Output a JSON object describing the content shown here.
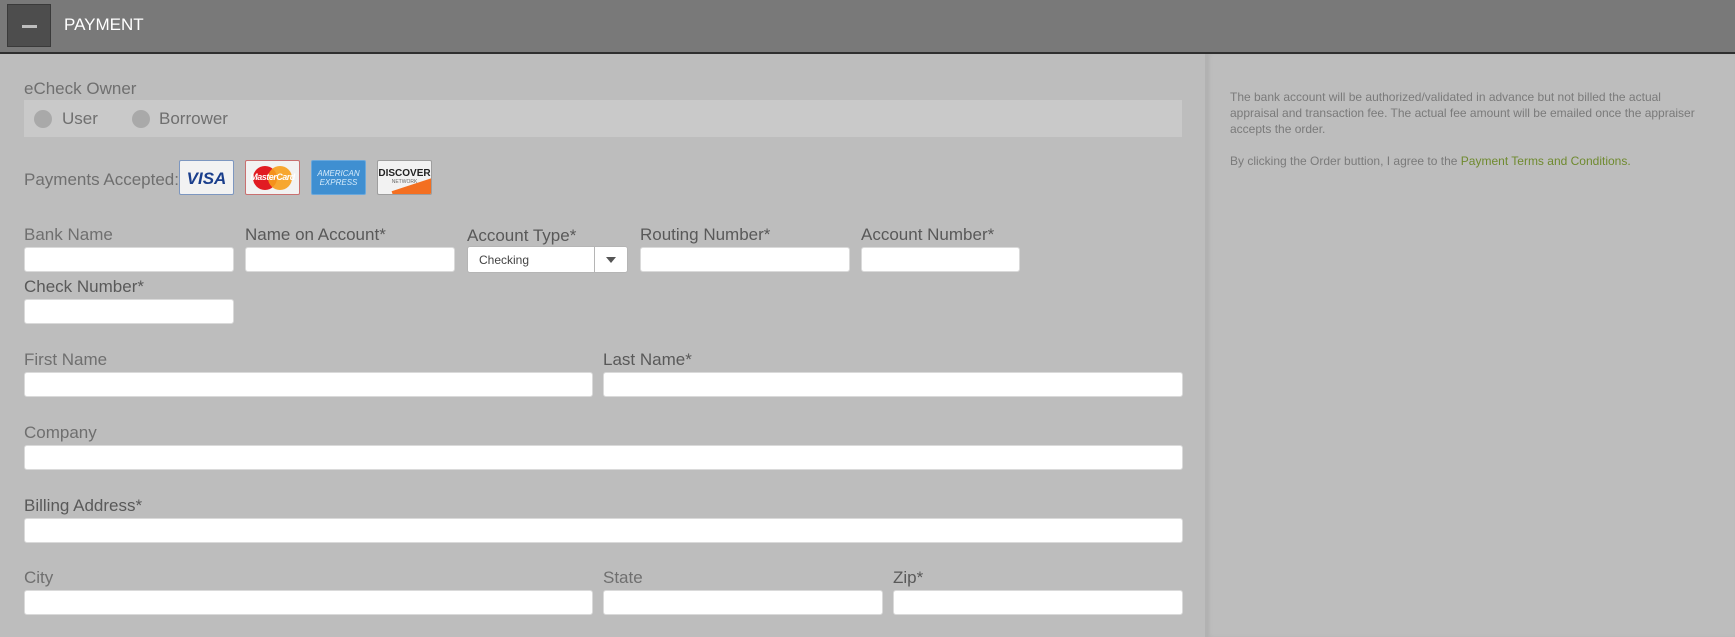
{
  "header": {
    "title": "PAYMENT"
  },
  "owner": {
    "label": "eCheck Owner",
    "options": [
      "User",
      "Borrower"
    ]
  },
  "payments": {
    "label": "Payments Accepted:",
    "cards": {
      "visa": "VISA",
      "mastercard": "MasterCard",
      "amex": "AMERICAN EXPRESS",
      "discover": "DISCOVER",
      "discover_sub": "NETWORK"
    }
  },
  "fields": {
    "bank_name": "Bank Name",
    "name_on_account": "Name on Account*",
    "account_type": "Account Type*",
    "account_type_value": "Checking",
    "routing_number": "Routing Number*",
    "account_number": "Account Number*",
    "check_number": "Check Number*",
    "first_name": "First Name",
    "last_name": "Last Name*",
    "company": "Company",
    "billing_address": "Billing Address*",
    "city": "City",
    "state": "State",
    "zip": "Zip*"
  },
  "side": {
    "notice": "The bank account will be authorized/validated in advance but not billed the actual appraisal and transaction fee. The actual fee amount will be emailed once the appraiser accepts the order.",
    "agree_prefix": "By clicking the Order buttion, I agree to the ",
    "terms_link": "Payment Terms and Conditions",
    "agree_suffix": "."
  },
  "colors": {
    "background": "#bdbdbd",
    "header": "#797979",
    "link": "#6f8a2f"
  },
  "icons": {
    "collapse": "minus-icon",
    "dropdown": "chevron-down-icon"
  }
}
